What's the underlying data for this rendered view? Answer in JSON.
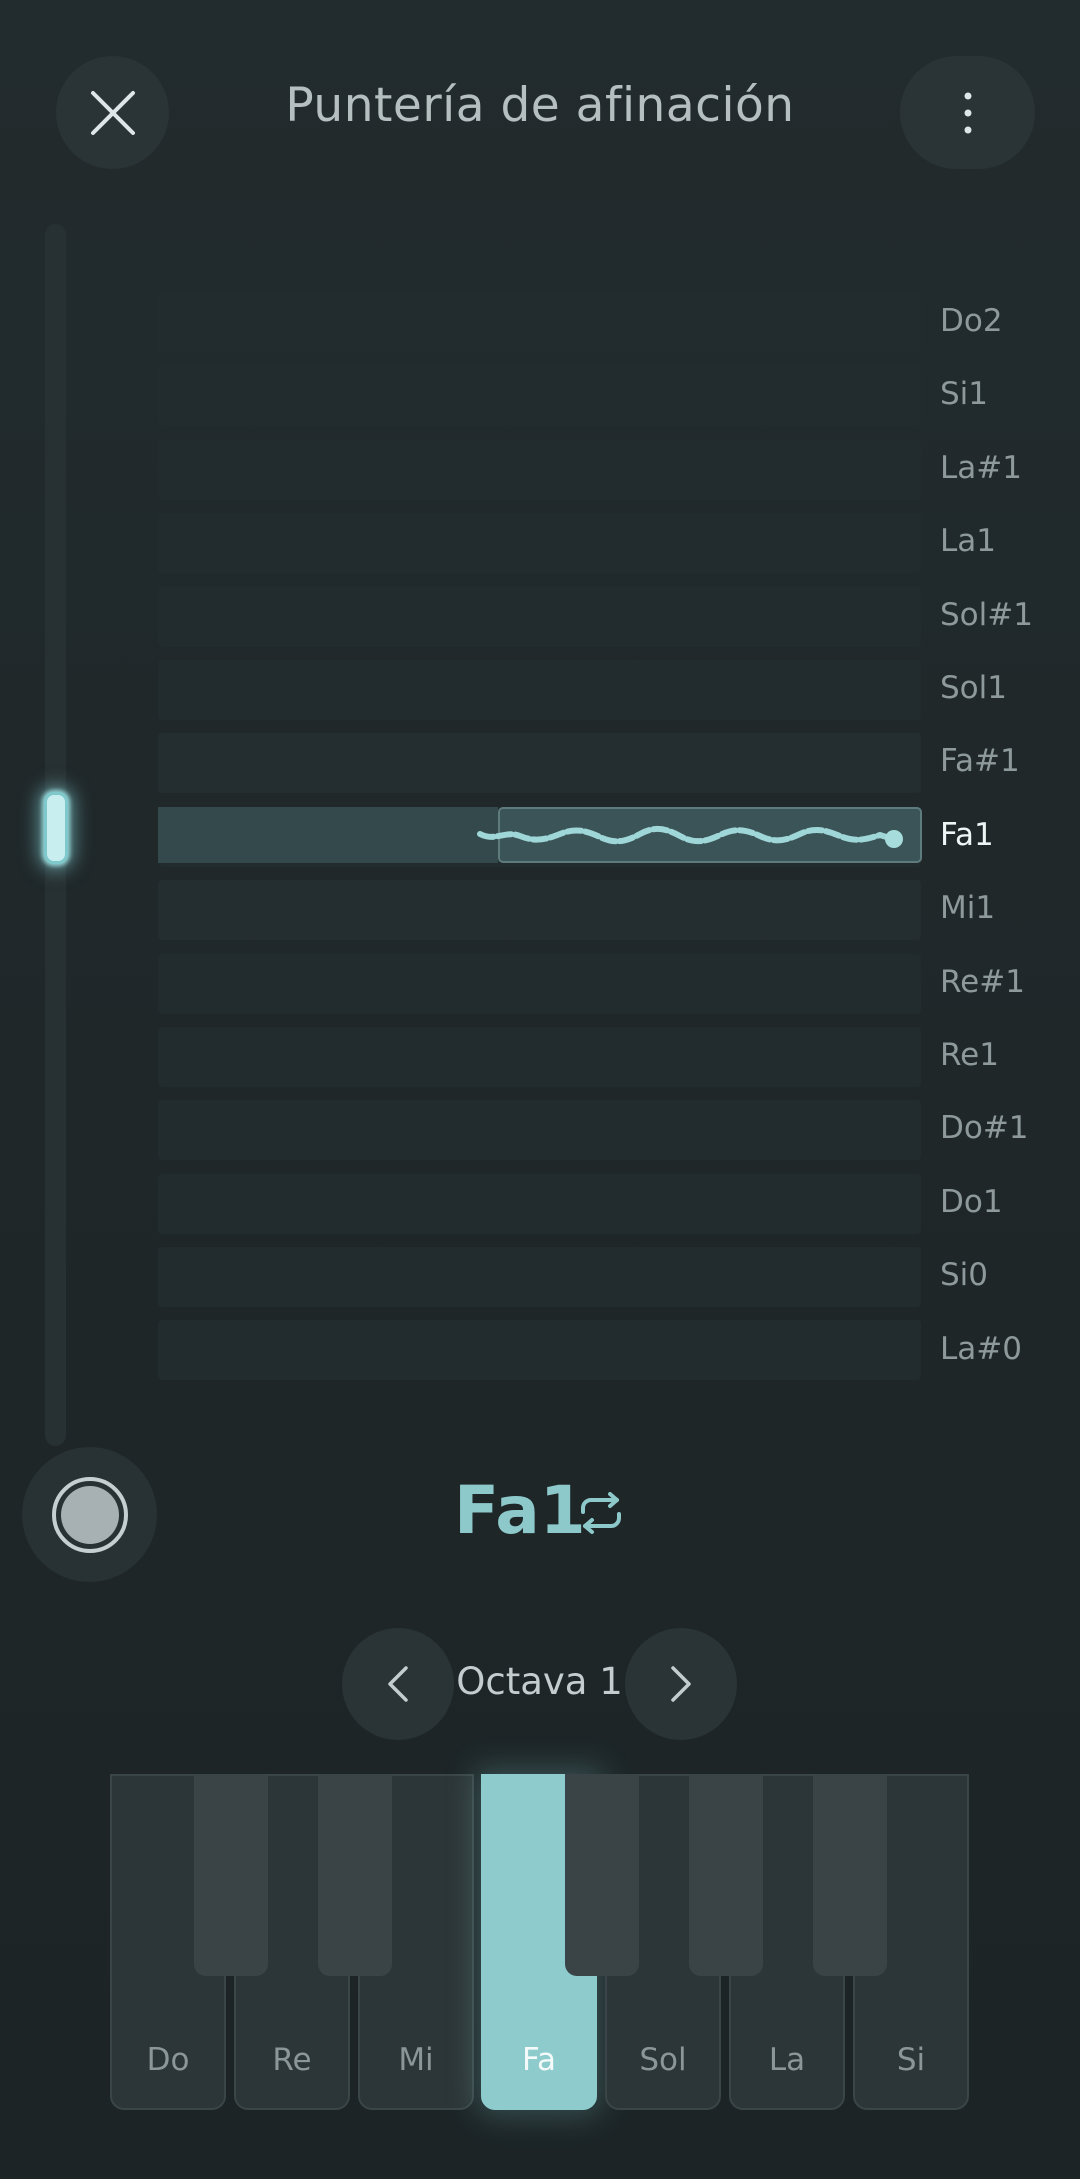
{
  "header": {
    "title": "Puntería de afinación",
    "close_icon": "close-icon",
    "more_icon": "more-vertical-icon"
  },
  "notes": [
    "Do2",
    "Si1",
    "La#1",
    "La1",
    "Sol#1",
    "Sol1",
    "Fa#1",
    "Fa1",
    "Mi1",
    "Re#1",
    "Re1",
    "Do#1",
    "Do1",
    "Si0",
    "La#0"
  ],
  "active_note_label": "Fa1",
  "current_note": "Fa1",
  "octave": {
    "label": "Octava 1"
  },
  "keyboard": {
    "white_keys": [
      "Do",
      "Re",
      "Mi",
      "Fa",
      "Sol",
      "La",
      "Si"
    ],
    "active_key": "Fa"
  },
  "colors": {
    "accent": "#8ecbcc",
    "background": "#1f2729",
    "surface": "#2a3335"
  }
}
